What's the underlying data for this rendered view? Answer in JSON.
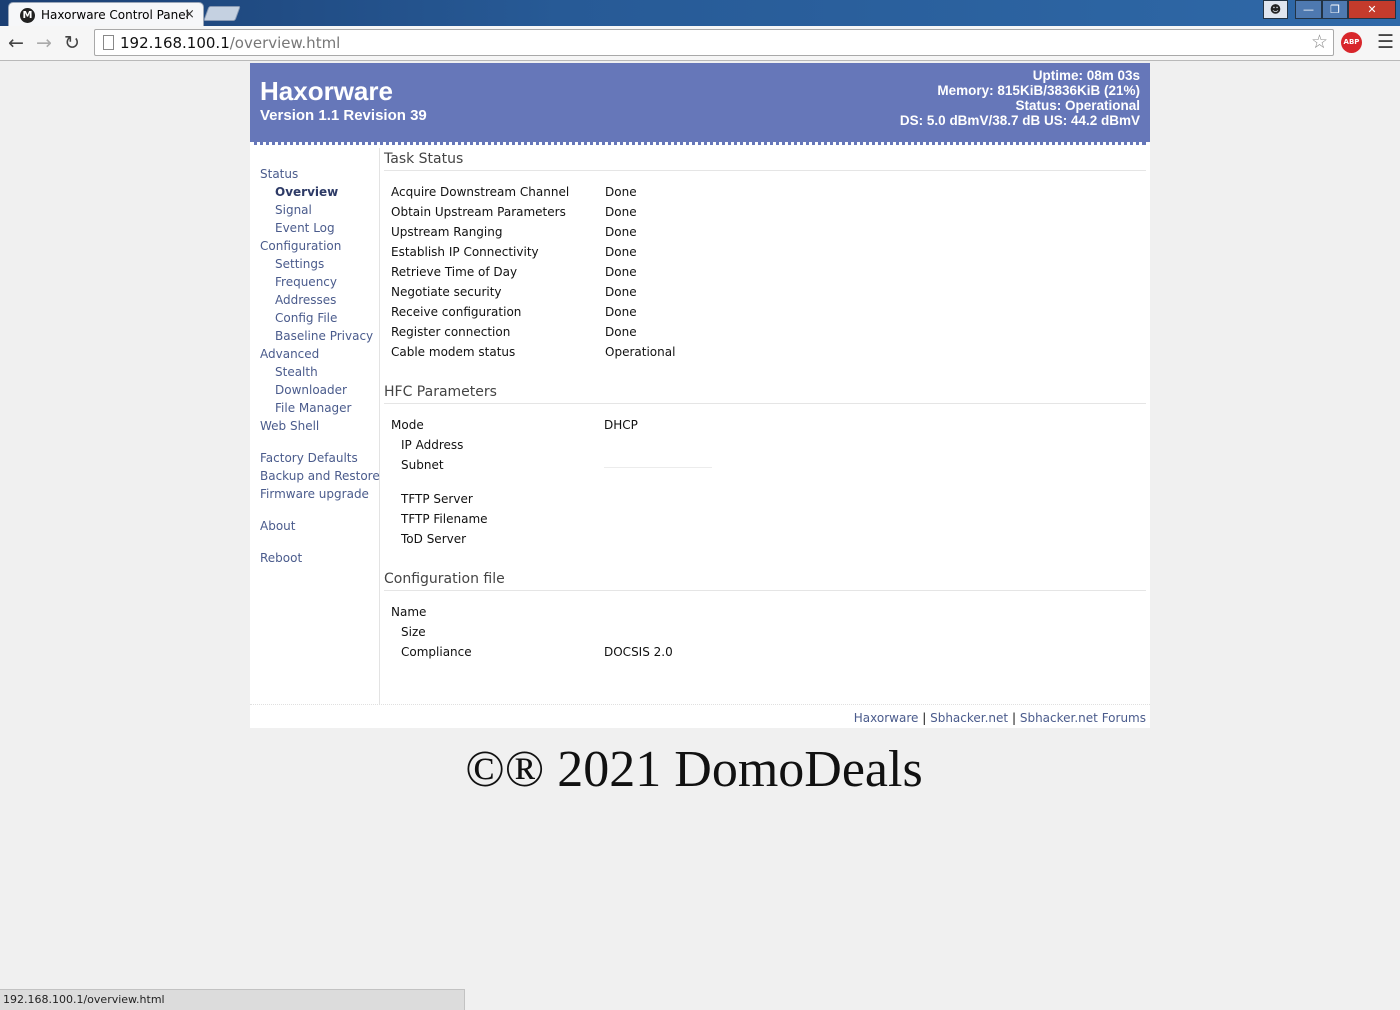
{
  "browser": {
    "tab_title": "Haxorware Control Panel",
    "tab_close": "×",
    "url_host": "192.168.100.1",
    "url_path": "/overview.html",
    "abp_label": "ABP",
    "status_url": "192.168.100.1/overview.html"
  },
  "header": {
    "title": "Haxorware",
    "version": "Version 1.1 Revision 39",
    "uptime": "Uptime: 08m 03s",
    "memory": "Memory: 815KiB/3836KiB (21%)",
    "status": "Status: Operational",
    "levels": "DS: 5.0 dBmV/38.7 dB US: 44.2 dBmV"
  },
  "sidebar": {
    "status": "Status",
    "overview": "Overview",
    "signal": "Signal",
    "event_log": "Event Log",
    "configuration": "Configuration",
    "settings": "Settings",
    "frequency": "Frequency",
    "addresses": "Addresses",
    "config_file": "Config File",
    "baseline_privacy": "Baseline Privacy",
    "advanced": "Advanced",
    "stealth": "Stealth",
    "downloader": "Downloader",
    "file_manager": "File Manager",
    "web_shell": "Web Shell",
    "factory_defaults": "Factory Defaults",
    "backup_restore": "Backup and Restore",
    "firmware_upgrade": "Firmware upgrade",
    "about": "About",
    "reboot": "Reboot"
  },
  "task_status": {
    "title": "Task Status",
    "rows": [
      {
        "label": "Acquire Downstream Channel",
        "value": "Done"
      },
      {
        "label": "Obtain Upstream Parameters",
        "value": "Done"
      },
      {
        "label": "Upstream Ranging",
        "value": "Done"
      },
      {
        "label": "Establish IP Connectivity",
        "value": "Done"
      },
      {
        "label": "Retrieve Time of Day",
        "value": "Done"
      },
      {
        "label": "Negotiate security",
        "value": "Done"
      },
      {
        "label": "Receive configuration",
        "value": "Done"
      },
      {
        "label": "Register connection",
        "value": "Done"
      },
      {
        "label": "Cable modem status",
        "value": "Operational"
      }
    ]
  },
  "hfc": {
    "title": "HFC Parameters",
    "mode_label": "Mode",
    "mode_value": "DHCP",
    "ip_label": "IP Address",
    "subnet_label": "Subnet",
    "tftp_server_label": "TFTP Server",
    "tftp_filename_label": "TFTP Filename",
    "tod_server_label": "ToD Server"
  },
  "config_file": {
    "title": "Configuration file",
    "name_label": "Name",
    "size_label": "Size",
    "compliance_label": "Compliance",
    "compliance_value": "DOCSIS 2.0"
  },
  "footer": {
    "link1": "Haxorware",
    "link2": "Sbhacker.net",
    "link3": "Sbhacker.net Forums",
    "sep": "|"
  },
  "watermark": "©® 2021 DomoDeals"
}
